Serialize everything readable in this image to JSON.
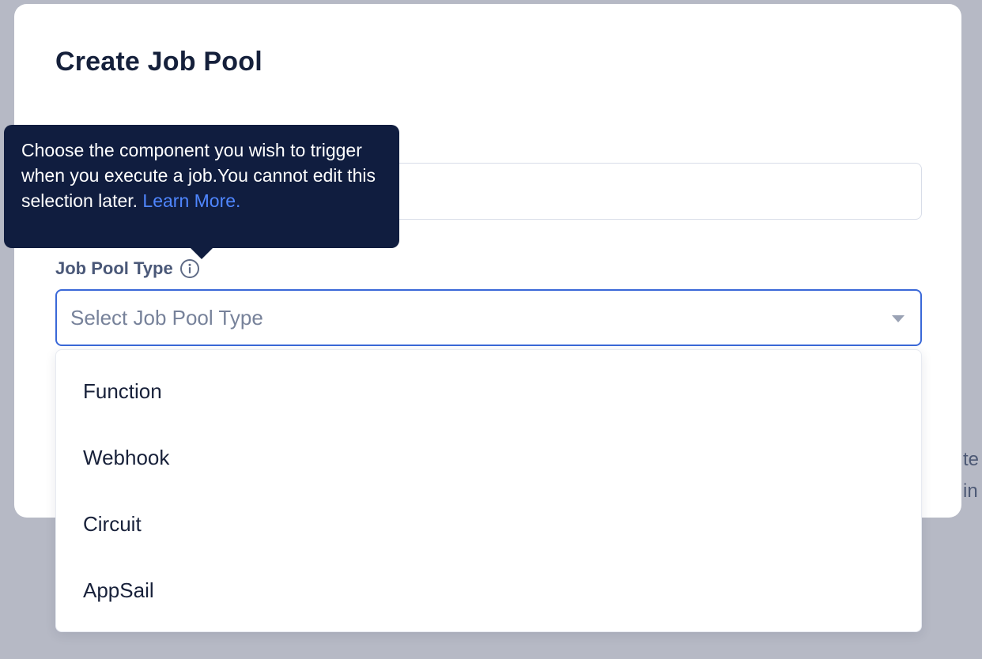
{
  "modal": {
    "title": "Create Job Pool"
  },
  "form": {
    "name_value": "",
    "type_label": "Job Pool Type",
    "type_placeholder": "Select Job Pool Type"
  },
  "tooltip": {
    "text": "Choose the component you wish to trigger when you execute a job.You cannot edit this selection later.",
    "link_text": "Learn More."
  },
  "dropdown": {
    "options": [
      "Function",
      "Webhook",
      "Circuit",
      "AppSail"
    ]
  },
  "background": {
    "fragment_1": "te",
    "fragment_2": "in"
  },
  "icons": {
    "info": "info-circle-icon",
    "caret": "caret-down-icon"
  },
  "colors": {
    "overlay": "#b6b9c5",
    "accent": "#3a68d8",
    "tooltip_bg": "#101d3f",
    "link": "#4f86ff"
  }
}
